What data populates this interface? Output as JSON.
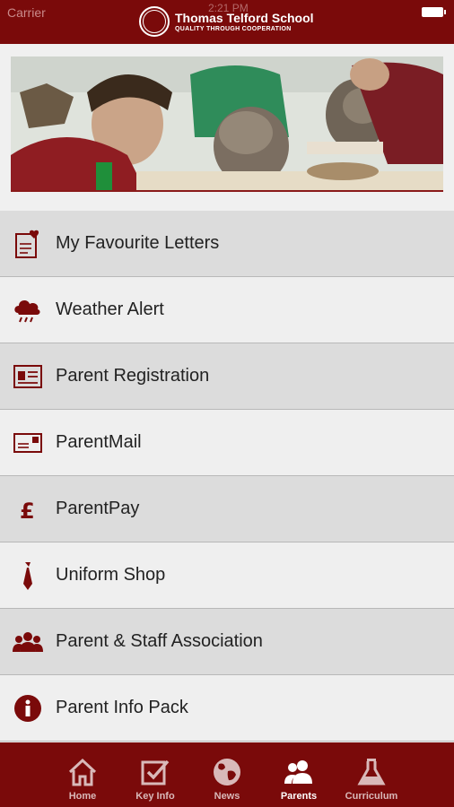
{
  "status_bar": {
    "carrier": "Carrier",
    "time": "2:21 PM"
  },
  "header": {
    "school_name": "Thomas Telford School",
    "tagline": "QUALITY THROUGH COOPERATION"
  },
  "menu": {
    "items": [
      {
        "label": "My Favourite Letters",
        "icon": "favourite-letter-icon"
      },
      {
        "label": "Weather Alert",
        "icon": "storm-cloud-icon"
      },
      {
        "label": "Parent Registration",
        "icon": "id-card-icon"
      },
      {
        "label": "ParentMail",
        "icon": "envelope-icon"
      },
      {
        "label": "ParentPay",
        "icon": "pound-sign-icon"
      },
      {
        "label": "Uniform Shop",
        "icon": "tie-icon"
      },
      {
        "label": "Parent & Staff Association",
        "icon": "group-icon"
      },
      {
        "label": "Parent Info Pack",
        "icon": "info-icon"
      }
    ]
  },
  "tabs": [
    {
      "label": "Home",
      "icon": "house-icon",
      "active": false
    },
    {
      "label": "Key Info",
      "icon": "checkbox-icon",
      "active": false
    },
    {
      "label": "News",
      "icon": "globe-icon",
      "active": false
    },
    {
      "label": "Parents",
      "icon": "people-icon",
      "active": true
    },
    {
      "label": "Curriculum",
      "icon": "flask-icon",
      "active": false
    }
  ],
  "colors": {
    "brand": "#7a0a0a",
    "row_dark": "#dcdcdc",
    "row_light": "#efefef"
  }
}
